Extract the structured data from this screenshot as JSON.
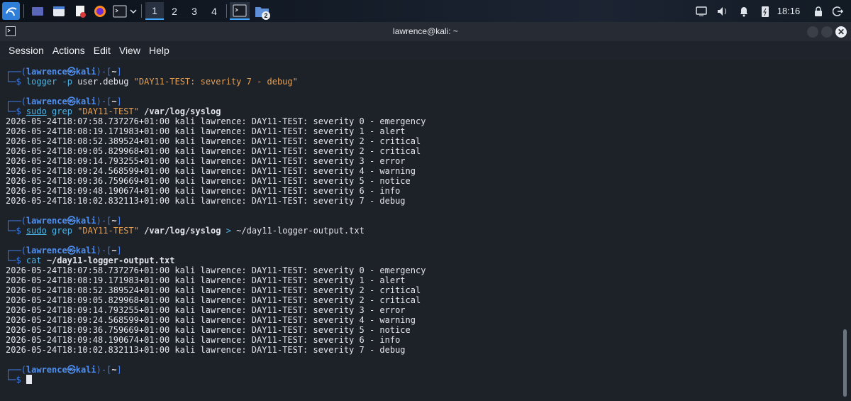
{
  "taskbar": {
    "workspaces": [
      "1",
      "2",
      "3",
      "4"
    ],
    "active_workspace": "1",
    "badge": "2",
    "clock": "18:16",
    "icons": [
      "kali-menu-icon",
      "show-desktop-icon",
      "file-manager-icon",
      "text-editor-icon",
      "firefox-icon",
      "terminal-icon",
      "chevron-down-icon",
      "terminal-window-icon",
      "folder-icon",
      "display-icon",
      "volume-icon",
      "notifications-icon",
      "battery-icon",
      "lock-icon",
      "logout-icon"
    ]
  },
  "window": {
    "title": "lawrence@kali: ~",
    "menu": [
      "Session",
      "Actions",
      "Edit",
      "View",
      "Help"
    ]
  },
  "prompt": {
    "user": "lawrence",
    "host": "kali",
    "cwd": "~"
  },
  "commands": {
    "c1": {
      "cmd": "logger",
      "opt": "-p",
      "arg": "user.debug",
      "str": "\"DAY11-TEST: severity 7 - debug\""
    },
    "c2": {
      "sudo": "sudo",
      "cmd": "grep",
      "str": "\"DAY11-TEST\"",
      "path": "/var/log/syslog"
    },
    "c3": {
      "sudo": "sudo",
      "cmd": "grep",
      "str": "\"DAY11-TEST\"",
      "path": "/var/log/syslog",
      "redir": ">",
      "target": "~/day11-logger-output.txt"
    },
    "c4": {
      "cmd": "cat",
      "path": "~/day11-logger-output.txt"
    }
  },
  "output1": [
    "2026-05-24T18:07:58.737276+01:00 kali lawrence: DAY11-TEST: severity 0 - emergency",
    "2026-05-24T18:08:19.171983+01:00 kali lawrence: DAY11-TEST: severity 1 - alert",
    "2026-05-24T18:08:52.389524+01:00 kali lawrence: DAY11-TEST: severity 2 - critical",
    "2026-05-24T18:09:05.829968+01:00 kali lawrence: DAY11-TEST: severity 2 - critical",
    "2026-05-24T18:09:14.793255+01:00 kali lawrence: DAY11-TEST: severity 3 - error",
    "2026-05-24T18:09:24.568599+01:00 kali lawrence: DAY11-TEST: severity 4 - warning",
    "2026-05-24T18:09:36.759669+01:00 kali lawrence: DAY11-TEST: severity 5 - notice",
    "2026-05-24T18:09:48.190674+01:00 kali lawrence: DAY11-TEST: severity 6 - info",
    "2026-05-24T18:10:02.832113+01:00 kali lawrence: DAY11-TEST: severity 7 - debug"
  ],
  "output2": [
    "2026-05-24T18:07:58.737276+01:00 kali lawrence: DAY11-TEST: severity 0 - emergency",
    "2026-05-24T18:08:19.171983+01:00 kali lawrence: DAY11-TEST: severity 1 - alert",
    "2026-05-24T18:08:52.389524+01:00 kali lawrence: DAY11-TEST: severity 2 - critical",
    "2026-05-24T18:09:05.829968+01:00 kali lawrence: DAY11-TEST: severity 2 - critical",
    "2026-05-24T18:09:14.793255+01:00 kali lawrence: DAY11-TEST: severity 3 - error",
    "2026-05-24T18:09:24.568599+01:00 kali lawrence: DAY11-TEST: severity 4 - warning",
    "2026-05-24T18:09:36.759669+01:00 kali lawrence: DAY11-TEST: severity 5 - notice",
    "2026-05-24T18:09:48.190674+01:00 kali lawrence: DAY11-TEST: severity 6 - info",
    "2026-05-24T18:10:02.832113+01:00 kali lawrence: DAY11-TEST: severity 7 - debug"
  ],
  "colors": {
    "accent": "#3fa7ff",
    "prompt_blue": "#3f7ee8",
    "string_orange": "#e8a052",
    "command_cyan": "#4cb4e6"
  }
}
